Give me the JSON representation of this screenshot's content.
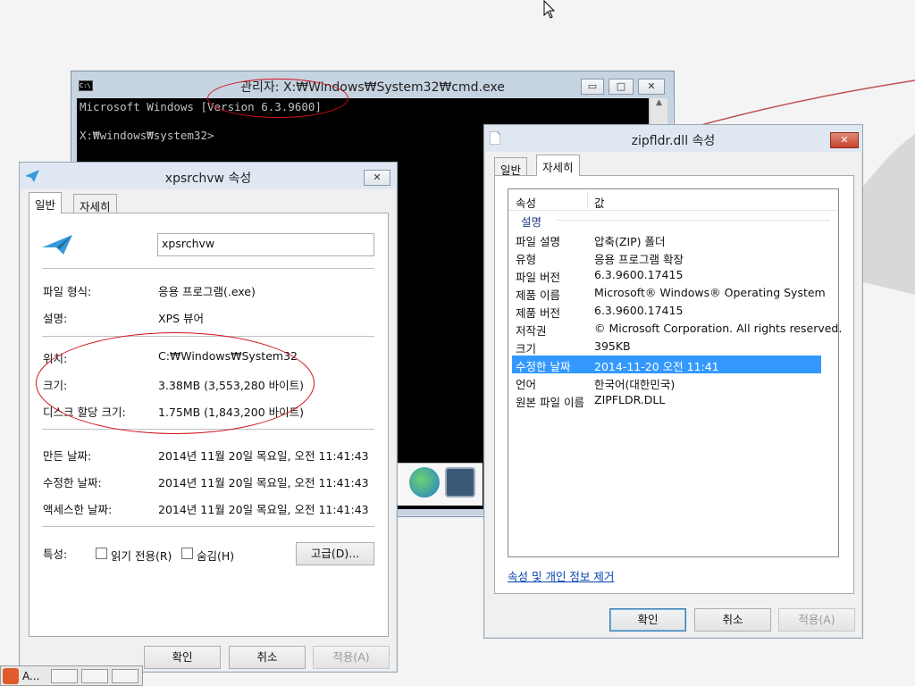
{
  "cmd_window": {
    "title": "관리자: X:₩Windows₩System32₩cmd.exe",
    "icon_text": "C:\\",
    "line1": "Microsoft Windows [Version 6.3.9600]",
    "line2": "",
    "line3": "X:₩windows₩system32>"
  },
  "xps_dialog": {
    "title": "xpsrchvw 속성",
    "tabs": [
      "일반",
      "자세히"
    ],
    "name_value": "xpsrchvw",
    "rows": [
      {
        "label": "파일 형식:",
        "value": "응용 프로그램(.exe)"
      },
      {
        "label": "설명:",
        "value": "XPS 뷰어"
      },
      {
        "label": "위치:",
        "value": "C:₩Windows₩System32"
      },
      {
        "label": "크기:",
        "value": "3.38MB (3,553,280 바이트)"
      },
      {
        "label": "디스크 할당 크기:",
        "value": "1.75MB (1,843,200 바이트)"
      },
      {
        "label": "만든 날짜:",
        "value": "2014년 11월 20일 목요일, 오전 11:41:43"
      },
      {
        "label": "수정한 날짜:",
        "value": "2014년 11월 20일 목요일, 오전 11:41:43"
      },
      {
        "label": "액세스한 날짜:",
        "value": "2014년 11월 20일 목요일, 오전 11:41:43"
      }
    ],
    "attributes_label": "특성:",
    "readonly_label": "읽기 전용(R)",
    "hidden_label": "숨김(H)",
    "advanced_button": "고급(D)...",
    "ok_button": "확인",
    "cancel_button": "취소",
    "apply_button": "적용(A)"
  },
  "zip_dialog": {
    "title": "zipfldr.dll 속성",
    "tabs": [
      "일반",
      "자세히"
    ],
    "col_property": "속성",
    "col_value": "값",
    "group_label": "설명",
    "rows": [
      {
        "label": "파일 설명",
        "value": "압축(ZIP) 폴더"
      },
      {
        "label": "유형",
        "value": "응용 프로그램 확장"
      },
      {
        "label": "파일 버전",
        "value": "6.3.9600.17415"
      },
      {
        "label": "제품 이름",
        "value": "Microsoft® Windows® Operating System"
      },
      {
        "label": "제품 버전",
        "value": "6.3.9600.17415"
      },
      {
        "label": "저작권",
        "value": "© Microsoft Corporation. All rights reserved."
      },
      {
        "label": "크기",
        "value": "395KB"
      },
      {
        "label": "수정한 날짜",
        "value": "2014-11-20 오전 11:41"
      },
      {
        "label": "언어",
        "value": "한국어(대한민국)"
      },
      {
        "label": "원본 파일 이름",
        "value": "ZIPFLDR.DLL"
      }
    ],
    "remove_link": "속성 및 개인 정보 제거",
    "ok_button": "확인",
    "cancel_button": "취소",
    "apply_button": "적용(A)"
  },
  "taskbar": {
    "item_label": "A..."
  },
  "colors": {
    "selection": "#3399ff",
    "annotation_red": "#d0101a",
    "console_bg": "#000000"
  }
}
